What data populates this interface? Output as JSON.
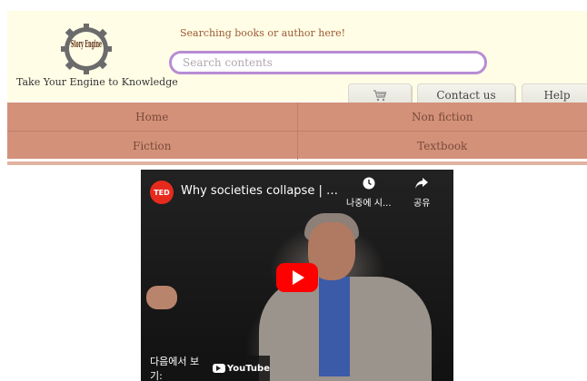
{
  "header": {
    "logo_text": "Story Engine",
    "tagline": "Take Your Engine to Knowledge",
    "search_label": "Searching books or author here!",
    "search_placeholder": "Search contents",
    "cart_icon": "cart-icon",
    "contact_label": "Contact us",
    "help_label": "Help"
  },
  "nav": {
    "items": [
      {
        "label": "Home"
      },
      {
        "label": "Non fiction"
      },
      {
        "label": "Fiction"
      },
      {
        "label": "Textbook"
      }
    ]
  },
  "video": {
    "channel_logo": "TED",
    "title": "Why societies collapse | Jared Diamond",
    "watch_later_label": "나중에 시...",
    "share_label": "공유",
    "watch_on_label": "다음에서 보기:",
    "youtube_label": "YouTube",
    "colors": {
      "play": "#ff0000",
      "ted": "#e62b1e"
    }
  },
  "colors": {
    "header_bg": "#fffde6",
    "nav_bg": "#d3917a",
    "search_border": "#b88cd4"
  }
}
